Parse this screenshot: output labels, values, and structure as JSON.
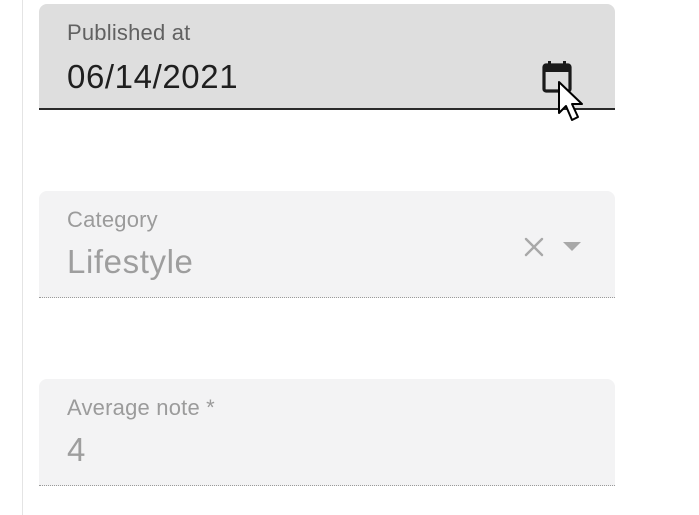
{
  "form": {
    "published_at": {
      "label": "Published at",
      "value": "06/14/2021",
      "icon": "calendar-icon",
      "state": "focused"
    },
    "category": {
      "label": "Category",
      "value": "Lifestyle",
      "icons": [
        "clear-icon",
        "dropdown-arrow-icon"
      ],
      "state": "disabled"
    },
    "average_note": {
      "label": "Average note *",
      "value": "4",
      "state": "disabled"
    }
  },
  "colors": {
    "focused_field_bg": "#dedede",
    "disabled_field_bg": "#f3f3f4",
    "focused_underline": "#2a2a2a",
    "text_dark": "#1f1f1f",
    "text_muted": "#9e9e9e"
  }
}
